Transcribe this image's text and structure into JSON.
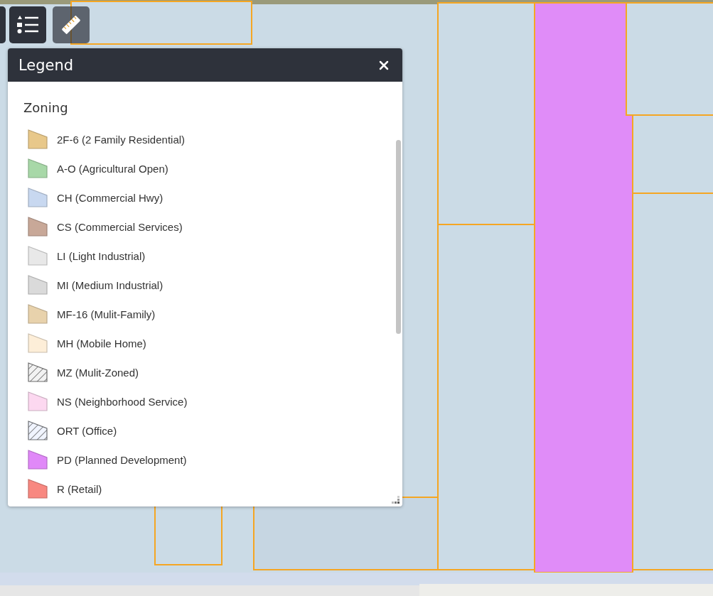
{
  "legend": {
    "title": "Legend",
    "section": "Zoning",
    "items": [
      {
        "label": "2F-6 (2 Family Residential)",
        "kind": "solid",
        "color": "#e8c88a"
      },
      {
        "label": "A-O (Agricultural Open)",
        "kind": "solid",
        "color": "#a8d8a8"
      },
      {
        "label": "CH (Commercial Hwy)",
        "kind": "solid",
        "color": "#c8d8f0"
      },
      {
        "label": "CS (Commercial Services)",
        "kind": "solid",
        "color": "#c8a898"
      },
      {
        "label": "LI (Light Industrial)",
        "kind": "solid",
        "color": "#e8e8e8"
      },
      {
        "label": "MI (Medium Industrial)",
        "kind": "solid",
        "color": "#dadada"
      },
      {
        "label": "MF-16 (Mulit-Family)",
        "kind": "solid",
        "color": "#e8d2ac"
      },
      {
        "label": "MH (Mobile Home)",
        "kind": "solid",
        "color": "#fdeed8"
      },
      {
        "label": "MZ (Mulit-Zoned)",
        "kind": "hatched",
        "color": "#f2f2f2"
      },
      {
        "label": "NS (Neighborhood Service)",
        "kind": "solid",
        "color": "#fcd8f0"
      },
      {
        "label": "ORT (Office)",
        "kind": "hatched",
        "color": "#f0f4ff"
      },
      {
        "label": "PD (Planned Development)",
        "kind": "solid",
        "color": "#e088f8"
      },
      {
        "label": "R (Retail)",
        "kind": "solid",
        "color": "#f88880"
      }
    ]
  }
}
